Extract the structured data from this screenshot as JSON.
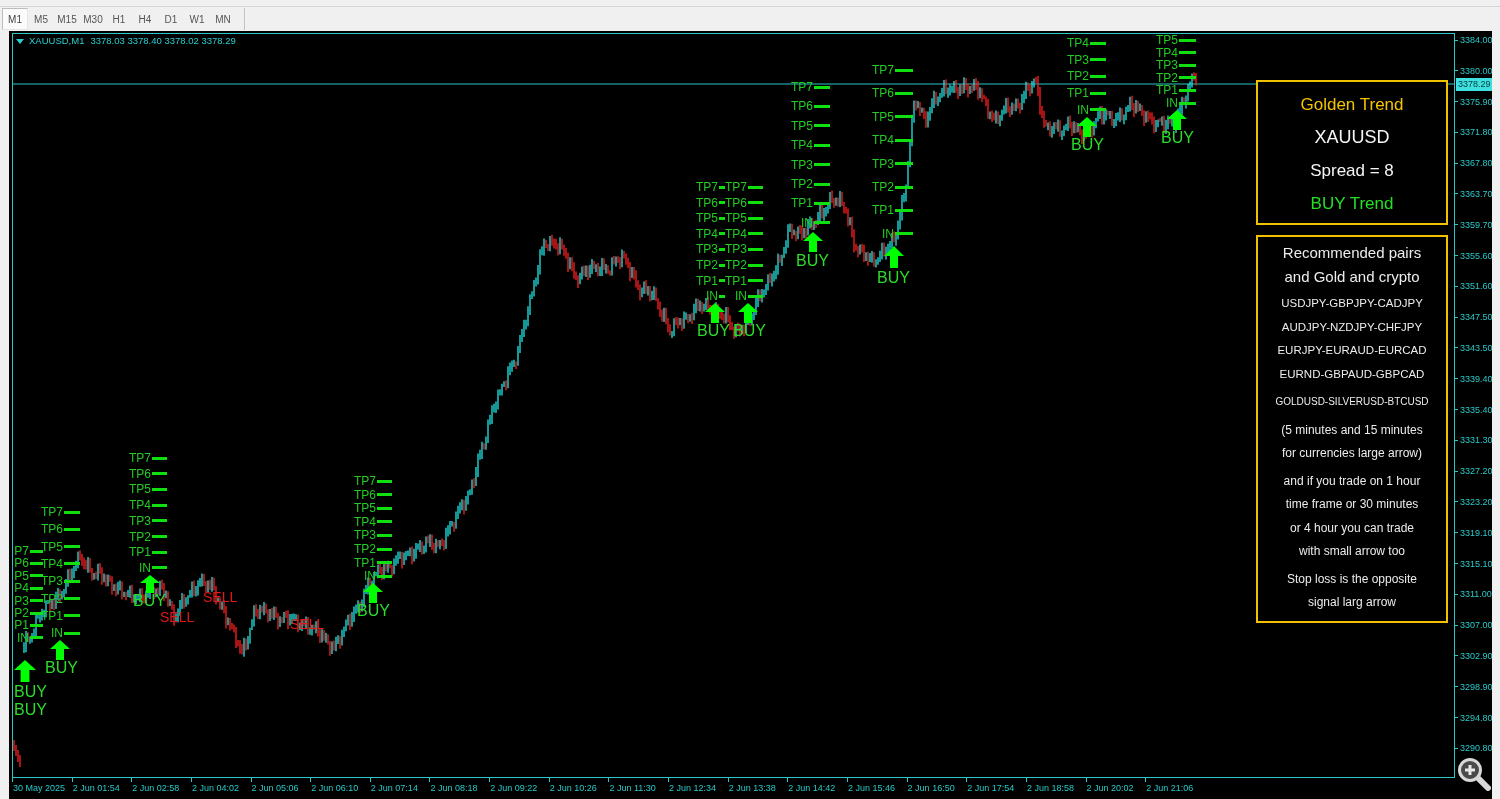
{
  "toolbar": {
    "timeframes": [
      {
        "label": "M1",
        "selected": true
      },
      {
        "label": "M5",
        "selected": false
      },
      {
        "label": "M15",
        "selected": false
      },
      {
        "label": "M30",
        "selected": false
      },
      {
        "label": "H1",
        "selected": false
      },
      {
        "label": "H4",
        "selected": false
      },
      {
        "label": "D1",
        "selected": false
      },
      {
        "label": "W1",
        "selected": false
      },
      {
        "label": "MN",
        "selected": false
      }
    ]
  },
  "chart": {
    "header": {
      "title": "XAUUSD,M1",
      "quotes": "3378.03 3378.40 3378.02 3378.29"
    },
    "signals": [
      {
        "kind": "buy",
        "arrow": true,
        "targets": [
          "P7",
          "P6",
          "P5",
          "P4",
          "P3",
          "P2",
          "P1"
        ],
        "entry": "IN",
        "label": "BUY"
      },
      {
        "kind": "buy",
        "arrow": false,
        "label": "BUY"
      },
      {
        "kind": "buy",
        "arrow": true,
        "targets": [
          "TP7",
          "TP6",
          "TP5",
          "TP4",
          "TP3",
          "TP2",
          "TP1"
        ],
        "entry": "IN",
        "label": "BUY"
      },
      {
        "kind": "buy",
        "arrow": true,
        "targets": [
          "TP7",
          "TP6",
          "TP5",
          "TP4",
          "TP3",
          "TP2",
          "TP1"
        ],
        "entry": "IN",
        "label": "BUY"
      },
      {
        "kind": "sell",
        "arrow": false,
        "label": "SELL"
      },
      {
        "kind": "sell",
        "arrow": false,
        "label": "SELL"
      },
      {
        "kind": "sell",
        "arrow": false,
        "label": "SELL"
      },
      {
        "kind": "buy",
        "arrow": true,
        "targets": [
          "TP7",
          "TP6",
          "TP5",
          "TP4",
          "TP3",
          "TP2",
          "TP1"
        ],
        "entry": "IN",
        "label": "BUY"
      },
      {
        "kind": "buy",
        "arrow": true,
        "targets": [
          "TP7",
          "TP6",
          "TP5",
          "TP4",
          "TP3",
          "TP2",
          "TP1"
        ],
        "entry": "IN",
        "label": "BUY"
      },
      {
        "kind": "buy",
        "arrow": true,
        "targets": [
          "TP7",
          "TP6",
          "TP5",
          "TP4",
          "TP3",
          "TP2",
          "TP1"
        ],
        "entry": "IN",
        "label": "BUY"
      },
      {
        "kind": "buy",
        "arrow": true,
        "targets": [
          "TP7",
          "TP6",
          "TP5",
          "TP4",
          "TP3",
          "TP2",
          "TP1"
        ],
        "entry": "IN",
        "label": "BUY"
      },
      {
        "kind": "buy",
        "arrow": true,
        "targets": [
          "TP7",
          "TP6",
          "TP5",
          "TP4",
          "TP3",
          "TP2",
          "TP1"
        ],
        "entry": "IN",
        "label": "BUY"
      },
      {
        "kind": "buy",
        "arrow": true,
        "targets": [
          "TP4",
          "TP3",
          "TP2",
          "TP1"
        ],
        "entry": "IN",
        "label": "BUY"
      },
      {
        "kind": "buy",
        "arrow": true,
        "targets": [
          "TP5",
          "TP4",
          "TP3",
          "TP2",
          "TP1"
        ],
        "entry": "IN",
        "label": "BUY"
      }
    ],
    "info_panel": {
      "title": "Golden Trend",
      "symbol": "XAUUSD",
      "spread": "Spread = 8",
      "trend": {
        "label": "BUY Trend",
        "kind": "buy"
      }
    },
    "notes_panel": {
      "heading": [
        "Recommended pairs",
        "and Gold and crypto"
      ],
      "pairs": [
        {
          "text": "USDJPY-GBPJPY-CADJPY",
          "kind": "pair"
        },
        {
          "text": "AUDJPY-NZDJPY-CHFJPY",
          "kind": "pair"
        },
        {
          "text": "EURJPY-EURAUD-EURCAD",
          "kind": "pair"
        },
        {
          "text": "EURND-GBPAUD-GBPCAD",
          "kind": "pair"
        },
        {
          "text": "GOLDUSD-SILVERUSD-BTCUSD",
          "kind": "small"
        }
      ],
      "notes": [
        [
          "(5 minutes and 15 minutes",
          "for currencies large arrow)"
        ],
        [
          "and if you trade on 1 hour",
          "time frame or 30 minutes",
          "or 4 hour you can trade",
          "with small arrow too"
        ],
        [
          "Stop loss is the opposite",
          "signal larg arrow"
        ]
      ]
    },
    "price_axis": {
      "labels": [
        "3384.00",
        "3380.00",
        "3375.90",
        "3371.80",
        "3367.80",
        "3363.70",
        "3359.70",
        "3355.60",
        "3351.60",
        "3347.50",
        "3343.50",
        "3339.40",
        "3335.40",
        "3331.30",
        "3327.20",
        "3323.20",
        "3319.10",
        "3315.10",
        "3311.00",
        "3307.00",
        "3302.90",
        "3298.90",
        "3294.80",
        "3290.80"
      ],
      "current_price": "3378.29"
    },
    "time_axis": {
      "labels": [
        "30 May 2025",
        "2 Jun 01:54",
        "2 Jun 02:58",
        "2 Jun 04:02",
        "2 Jun 05:06",
        "2 Jun 06:10",
        "2 Jun 07:14",
        "2 Jun 08:18",
        "2 Jun 09:22",
        "2 Jun 10:26",
        "2 Jun 11:30",
        "2 Jun 12:34",
        "2 Jun 13:38",
        "2 Jun 14:42",
        "2 Jun 15:46",
        "2 Jun 16:50",
        "2 Jun 17:54",
        "2 Jun 18:58",
        "2 Jun 20:02",
        "2 Jun 21:06"
      ]
    }
  }
}
